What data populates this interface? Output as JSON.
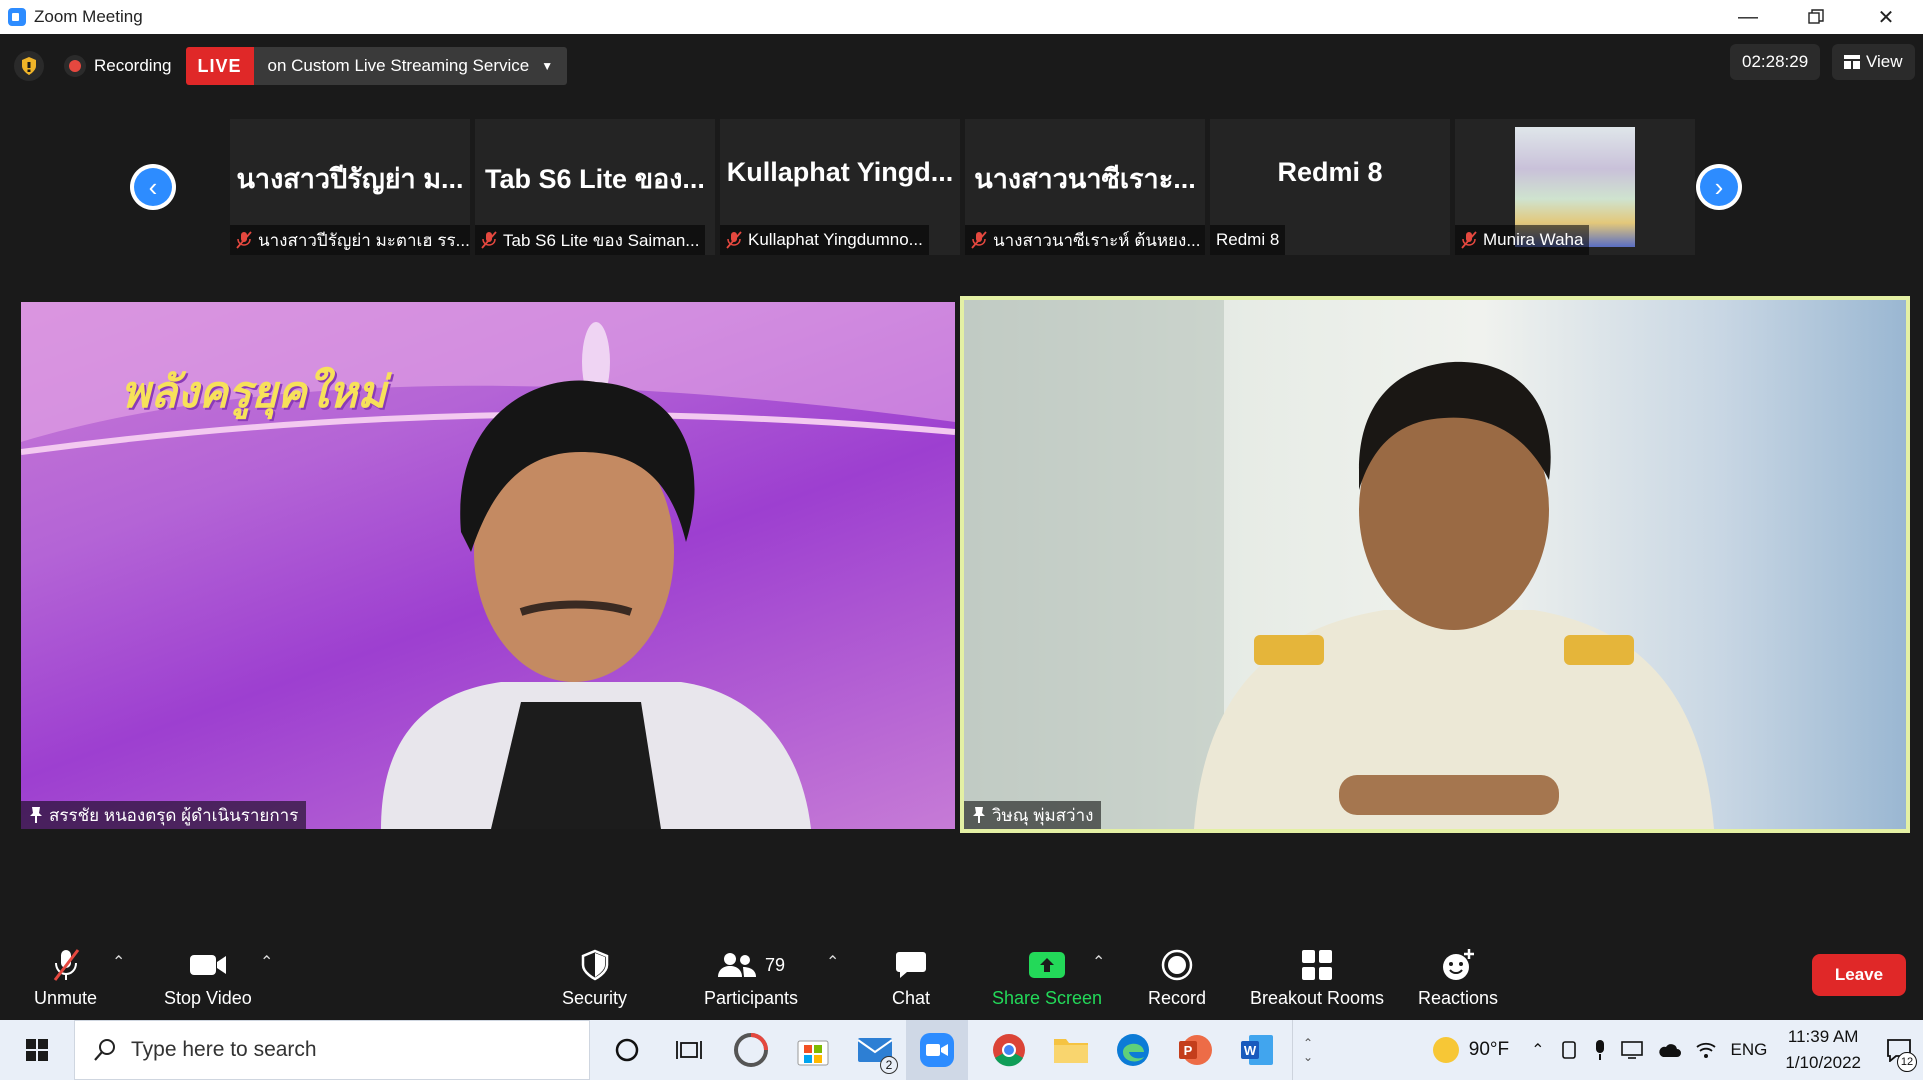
{
  "window": {
    "title": "Zoom Meeting"
  },
  "topbar": {
    "recording_label": "Recording",
    "live_badge": "LIVE",
    "live_service": "on Custom Live Streaming Service",
    "timer": "02:28:29",
    "view_label": "View"
  },
  "thumbnails": [
    {
      "big": "นางสาวปีรัญย่า ม...",
      "name": "นางสาวปีรัญย่า มะตาเฮ รร...",
      "muted": true
    },
    {
      "big": "Tab S6 Lite ของ...",
      "name": "Tab S6 Lite ของ Saiman...",
      "muted": true
    },
    {
      "big": "Kullaphat Yingd...",
      "name": "Kullaphat Yingdumno...",
      "muted": true
    },
    {
      "big": "นางสาวนาซีเราะ...",
      "name": "นางสาวนาซีเราะห์ ต้นหยง...",
      "muted": true
    },
    {
      "big": "Redmi 8",
      "name": "Redmi 8",
      "muted": false
    },
    {
      "big": "",
      "name": "Munira Waha",
      "muted": true,
      "video": true
    }
  ],
  "videos": {
    "left": {
      "name": "สรรชัย หนองตรุด ผู้ดำเนินรายการ",
      "overlay_text": "พลังครูยุคใหม่"
    },
    "right": {
      "name": "วิษณุ พุ่มสว่าง"
    }
  },
  "toolbar": {
    "unmute": "Unmute",
    "stop_video": "Stop Video",
    "security": "Security",
    "participants": "Participants",
    "participants_count": "79",
    "chat": "Chat",
    "share_screen": "Share Screen",
    "record": "Record",
    "breakout_rooms": "Breakout Rooms",
    "reactions": "Reactions",
    "leave": "Leave"
  },
  "taskbar": {
    "search_placeholder": "Type here to search",
    "mail_badge": "2",
    "weather": "90°F",
    "language": "ENG",
    "time": "11:39 AM",
    "date": "1/10/2022",
    "notification_count": "12"
  },
  "colors": {
    "accent_blue": "#2d8cff",
    "live_red": "#e02828",
    "share_green": "#23d959",
    "active_speaker_border": "#e4f0a4"
  }
}
